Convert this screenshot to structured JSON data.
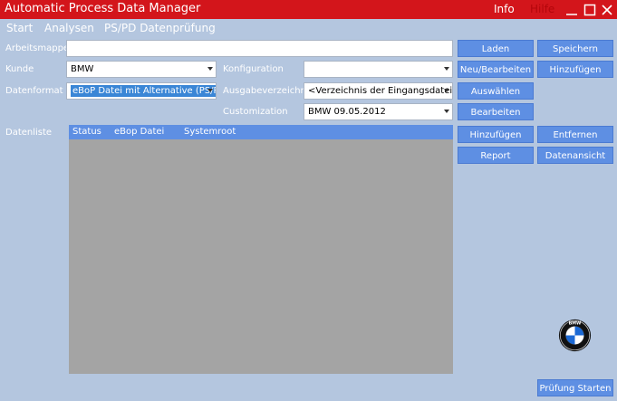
{
  "window": {
    "title": "Automatic Process Data Manager",
    "info": "Info",
    "hilfe": "Hilfe"
  },
  "menu": [
    "Start",
    "Analysen",
    "PS/PD Datenprüfung"
  ],
  "form": {
    "arbeitsmappe_label": "Arbeitsmappe",
    "arbeitsmappe_value": "",
    "kunde_label": "Kunde",
    "kunde_value": "BMW",
    "datenformat_label": "Datenformat",
    "datenformat_value": "eBoP Datei mit Alternative (PS/PD",
    "konfiguration_label": "Konfiguration",
    "konfiguration_value": "",
    "ausgabe_label": "Ausgabeverzeichnis",
    "ausgabe_value": "<Verzeichnis der Eingangsdatei>",
    "customization_label": "Customization",
    "customization_value": "BMW 09.05.2012",
    "datenliste_label": "Datenliste"
  },
  "list": {
    "columns": [
      "Status",
      "eBop Datei",
      "Systemroot"
    ]
  },
  "buttons": {
    "laden": "Laden",
    "speichern": "Speichern",
    "neu_bearbeiten": "Neu/Bearbeiten",
    "hinzufuegen_top": "Hinzufügen",
    "auswaehlen": "Auswählen",
    "bearbeiten": "Bearbeiten",
    "hinzufuegen": "Hinzufügen",
    "entfernen": "Entfernen",
    "report": "Report",
    "datenansicht": "Datenansicht",
    "pruefung": "Prüfung Starten"
  },
  "logo_text": "BMW",
  "colors": {
    "titlebar": "#d3151b",
    "background": "#b4c6df",
    "button": "#5e8fe3",
    "list": "#a4a4a4"
  }
}
